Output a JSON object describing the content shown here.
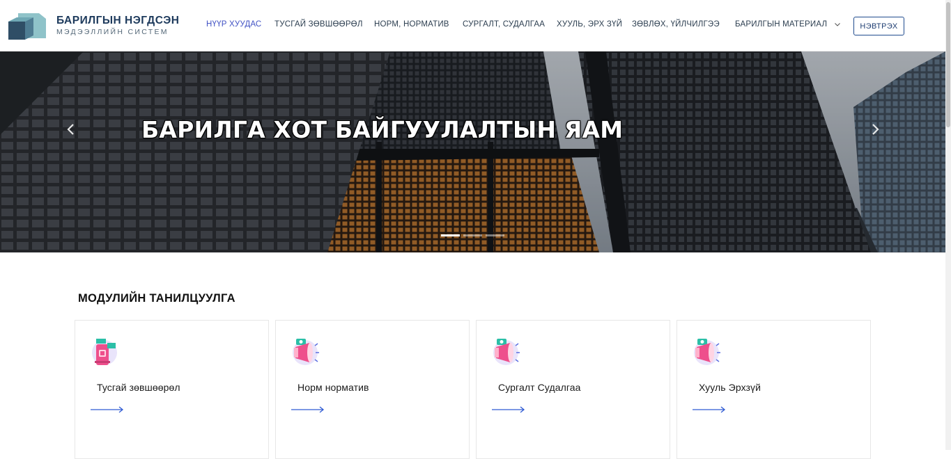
{
  "brand": {
    "title": "БАРИЛГЫН НЭГДСЭН",
    "subtitle": "МЭДЭЭЛЛИЙН СИСТЕМ",
    "logo_icon": "building-cube-logo"
  },
  "nav": {
    "items": [
      {
        "label": "НҮҮР ХУУДАС",
        "active": true
      },
      {
        "label": "ТУСГАЙ ЗӨВШӨӨРӨЛ",
        "active": false
      },
      {
        "label": "НОРМ, НОРМАТИВ",
        "active": false
      },
      {
        "label": "СУРГАЛТ, СУДАЛГАА",
        "active": false
      },
      {
        "label": "ХУУЛЬ, ЭРХ ЗҮЙ",
        "active": false
      },
      {
        "label": "ЗӨВЛӨХ, ҮЙЛЧИЛГЭЭ",
        "active": false
      },
      {
        "label": "БАРИЛГЫН МАТЕРИАЛ",
        "active": false,
        "has_dropdown": true
      }
    ],
    "login_label": "НЭВТРЭХ"
  },
  "hero": {
    "title": "БАРИЛГА ХОТ БАЙГУУЛАЛТЫН ЯАМ",
    "slide_count": 3,
    "active_slide": 1
  },
  "modules": {
    "title": "МОДУЛИЙН ТАНИЛЦУУЛГА",
    "cards": [
      {
        "label": "Тусгай зөвшөөрөл",
        "icon": "mailbox-icon"
      },
      {
        "label": "Норм норматив",
        "icon": "megaphone-icon"
      },
      {
        "label": "Сургалт Судалгаа",
        "icon": "megaphone-icon"
      },
      {
        "label": "Хууль Эрхзүй",
        "icon": "megaphone-icon"
      }
    ]
  },
  "colors": {
    "accent": "#4152c4",
    "brand_text": "#1d3a5c",
    "arrow": "#2f5bd3",
    "icon_pink": "#ee4f8c",
    "icon_teal": "#2bbfa7"
  }
}
